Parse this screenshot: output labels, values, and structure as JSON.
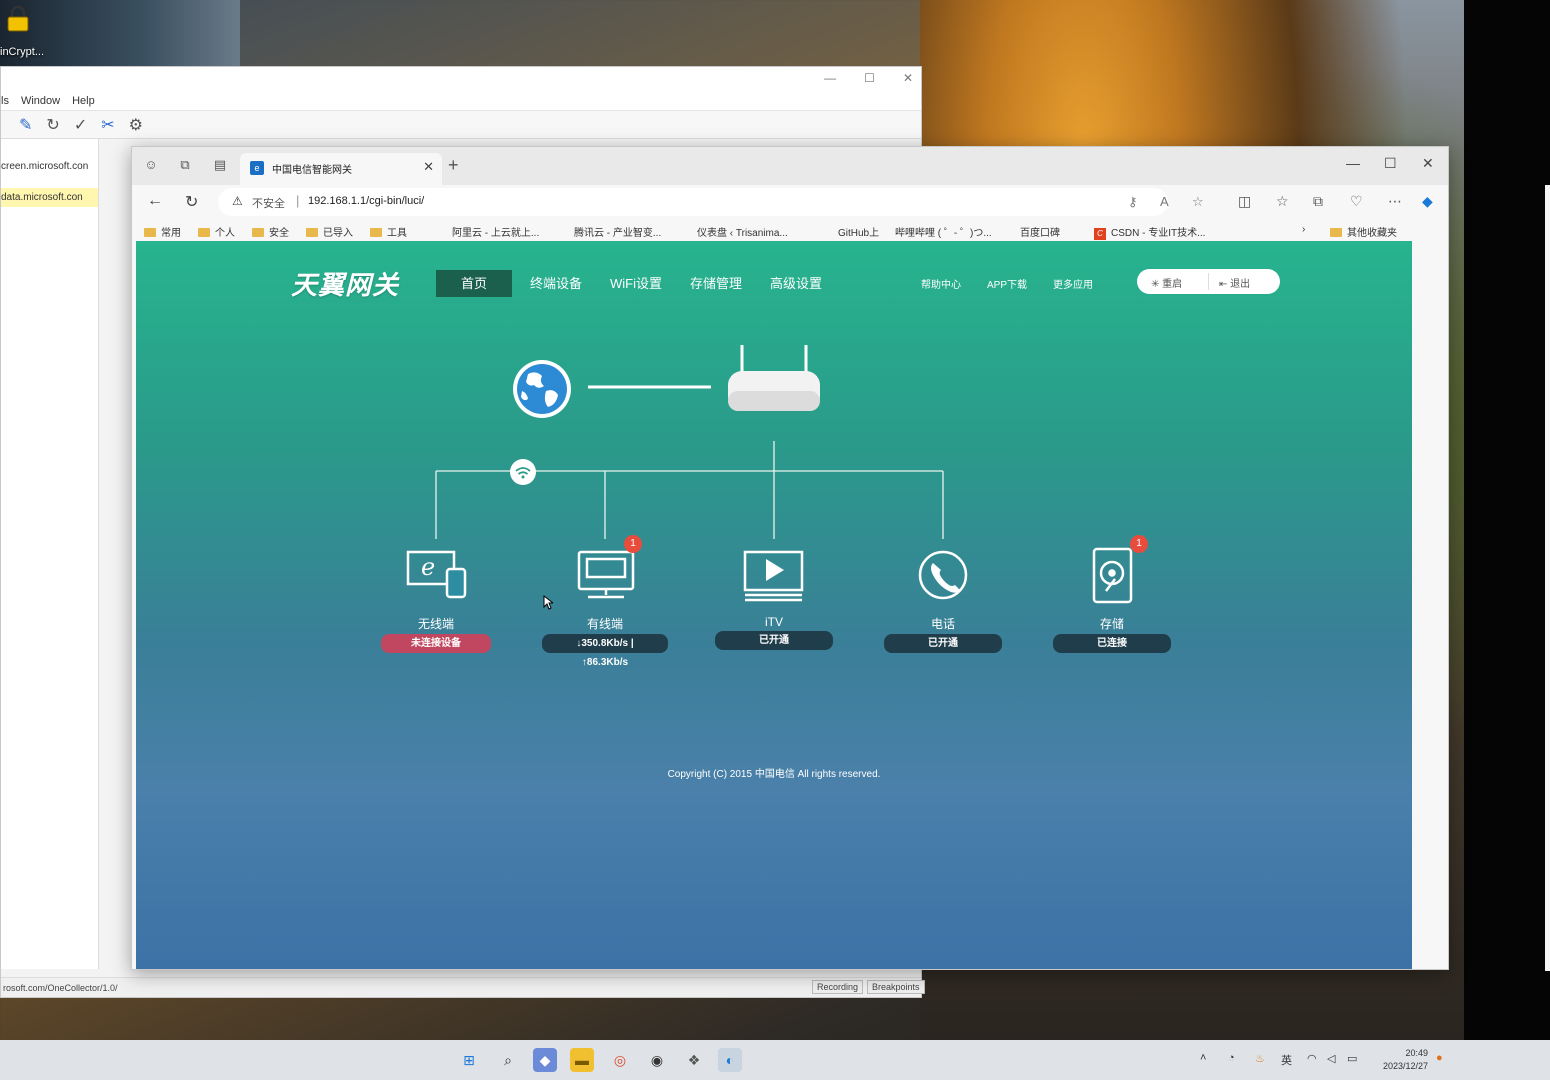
{
  "desktop": {
    "icon_label": "inCrypt..."
  },
  "bg_window": {
    "menu": [
      "ls",
      "Window",
      "Help"
    ],
    "side_rows": [
      "creen.microsoft.con",
      "data.microsoft.con"
    ],
    "status_url": "rosoft.com/OneCollector/1.0/",
    "status_buttons": [
      "Recording",
      "Breakpoints"
    ]
  },
  "browser": {
    "tab_title": "中国电信智能网关",
    "address": {
      "security_label": "不安全",
      "separator": "|",
      "url": "192.168.1.1/cgi-bin/luci/"
    },
    "bookmarks": [
      {
        "label": "常用",
        "type": "folder"
      },
      {
        "label": "个人",
        "type": "folder"
      },
      {
        "label": "安全",
        "type": "folder"
      },
      {
        "label": "已导入",
        "type": "folder"
      },
      {
        "label": "工具",
        "type": "folder"
      },
      {
        "label": "",
        "type": "page"
      },
      {
        "label": "阿里云 - 上云就上...",
        "type": "page"
      },
      {
        "label": "腾讯云 - 产业智变...",
        "type": "page"
      },
      {
        "label": "仪表盘 ‹ Trisanima...",
        "type": "page"
      },
      {
        "label": "GitHub上",
        "type": "plain"
      },
      {
        "label": "哔哩哔哩 ( ゜- ゜)つ...",
        "type": "page"
      },
      {
        "label": "百度口碑",
        "type": "page"
      },
      {
        "label": "CSDN - 专业IT技术...",
        "type": "csdn"
      }
    ],
    "other_bookmarks": "其他收藏夹"
  },
  "router": {
    "logo": "天翼网关",
    "nav": [
      "首页",
      "终端设备",
      "WiFi设置",
      "存储管理",
      "高级设置"
    ],
    "active_nav": "首页",
    "top_links": [
      "帮助中心",
      "APP下载",
      "更多应用"
    ],
    "reboot_label": "重启",
    "logout_label": "退出",
    "devices": [
      {
        "name": "无线端",
        "status": "未连接设备",
        "status_color": "#c0475f",
        "badge": ""
      },
      {
        "name": "有线端",
        "status": "↓350.8Kb/s | ↑86.3Kb/s",
        "status_color": "#1f3d4a",
        "badge": "1"
      },
      {
        "name": "iTV",
        "status": "已开通",
        "status_color": "#1f3d4a",
        "badge": ""
      },
      {
        "name": "电话",
        "status": "已开通",
        "status_color": "#1f3d4a",
        "badge": ""
      },
      {
        "name": "存储",
        "status": "已连接",
        "status_color": "#1f3d4a",
        "badge": "1"
      }
    ],
    "copyright": "Copyright (C) 2015 中国电信 All rights reserved."
  },
  "taskbar": {
    "tray_lang": "英",
    "time": "20:49",
    "date": "2023/12/27"
  }
}
